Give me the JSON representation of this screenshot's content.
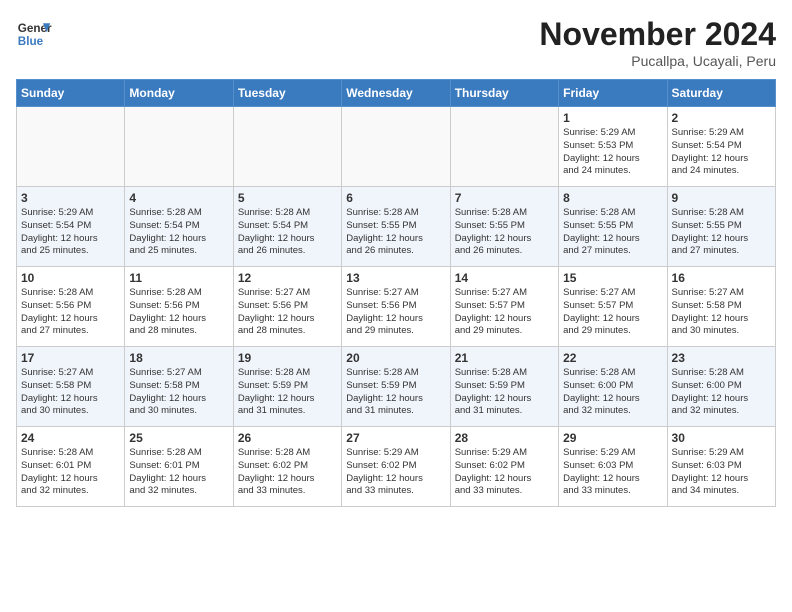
{
  "header": {
    "logo_line1": "General",
    "logo_line2": "Blue",
    "month": "November 2024",
    "location": "Pucallpa, Ucayali, Peru"
  },
  "weekdays": [
    "Sunday",
    "Monday",
    "Tuesday",
    "Wednesday",
    "Thursday",
    "Friday",
    "Saturday"
  ],
  "weeks": [
    [
      {
        "day": "",
        "info": ""
      },
      {
        "day": "",
        "info": ""
      },
      {
        "day": "",
        "info": ""
      },
      {
        "day": "",
        "info": ""
      },
      {
        "day": "",
        "info": ""
      },
      {
        "day": "1",
        "info": "Sunrise: 5:29 AM\nSunset: 5:53 PM\nDaylight: 12 hours\nand 24 minutes."
      },
      {
        "day": "2",
        "info": "Sunrise: 5:29 AM\nSunset: 5:54 PM\nDaylight: 12 hours\nand 24 minutes."
      }
    ],
    [
      {
        "day": "3",
        "info": "Sunrise: 5:29 AM\nSunset: 5:54 PM\nDaylight: 12 hours\nand 25 minutes."
      },
      {
        "day": "4",
        "info": "Sunrise: 5:28 AM\nSunset: 5:54 PM\nDaylight: 12 hours\nand 25 minutes."
      },
      {
        "day": "5",
        "info": "Sunrise: 5:28 AM\nSunset: 5:54 PM\nDaylight: 12 hours\nand 26 minutes."
      },
      {
        "day": "6",
        "info": "Sunrise: 5:28 AM\nSunset: 5:55 PM\nDaylight: 12 hours\nand 26 minutes."
      },
      {
        "day": "7",
        "info": "Sunrise: 5:28 AM\nSunset: 5:55 PM\nDaylight: 12 hours\nand 26 minutes."
      },
      {
        "day": "8",
        "info": "Sunrise: 5:28 AM\nSunset: 5:55 PM\nDaylight: 12 hours\nand 27 minutes."
      },
      {
        "day": "9",
        "info": "Sunrise: 5:28 AM\nSunset: 5:55 PM\nDaylight: 12 hours\nand 27 minutes."
      }
    ],
    [
      {
        "day": "10",
        "info": "Sunrise: 5:28 AM\nSunset: 5:56 PM\nDaylight: 12 hours\nand 27 minutes."
      },
      {
        "day": "11",
        "info": "Sunrise: 5:28 AM\nSunset: 5:56 PM\nDaylight: 12 hours\nand 28 minutes."
      },
      {
        "day": "12",
        "info": "Sunrise: 5:27 AM\nSunset: 5:56 PM\nDaylight: 12 hours\nand 28 minutes."
      },
      {
        "day": "13",
        "info": "Sunrise: 5:27 AM\nSunset: 5:56 PM\nDaylight: 12 hours\nand 29 minutes."
      },
      {
        "day": "14",
        "info": "Sunrise: 5:27 AM\nSunset: 5:57 PM\nDaylight: 12 hours\nand 29 minutes."
      },
      {
        "day": "15",
        "info": "Sunrise: 5:27 AM\nSunset: 5:57 PM\nDaylight: 12 hours\nand 29 minutes."
      },
      {
        "day": "16",
        "info": "Sunrise: 5:27 AM\nSunset: 5:58 PM\nDaylight: 12 hours\nand 30 minutes."
      }
    ],
    [
      {
        "day": "17",
        "info": "Sunrise: 5:27 AM\nSunset: 5:58 PM\nDaylight: 12 hours\nand 30 minutes."
      },
      {
        "day": "18",
        "info": "Sunrise: 5:27 AM\nSunset: 5:58 PM\nDaylight: 12 hours\nand 30 minutes."
      },
      {
        "day": "19",
        "info": "Sunrise: 5:28 AM\nSunset: 5:59 PM\nDaylight: 12 hours\nand 31 minutes."
      },
      {
        "day": "20",
        "info": "Sunrise: 5:28 AM\nSunset: 5:59 PM\nDaylight: 12 hours\nand 31 minutes."
      },
      {
        "day": "21",
        "info": "Sunrise: 5:28 AM\nSunset: 5:59 PM\nDaylight: 12 hours\nand 31 minutes."
      },
      {
        "day": "22",
        "info": "Sunrise: 5:28 AM\nSunset: 6:00 PM\nDaylight: 12 hours\nand 32 minutes."
      },
      {
        "day": "23",
        "info": "Sunrise: 5:28 AM\nSunset: 6:00 PM\nDaylight: 12 hours\nand 32 minutes."
      }
    ],
    [
      {
        "day": "24",
        "info": "Sunrise: 5:28 AM\nSunset: 6:01 PM\nDaylight: 12 hours\nand 32 minutes."
      },
      {
        "day": "25",
        "info": "Sunrise: 5:28 AM\nSunset: 6:01 PM\nDaylight: 12 hours\nand 32 minutes."
      },
      {
        "day": "26",
        "info": "Sunrise: 5:28 AM\nSunset: 6:02 PM\nDaylight: 12 hours\nand 33 minutes."
      },
      {
        "day": "27",
        "info": "Sunrise: 5:29 AM\nSunset: 6:02 PM\nDaylight: 12 hours\nand 33 minutes."
      },
      {
        "day": "28",
        "info": "Sunrise: 5:29 AM\nSunset: 6:02 PM\nDaylight: 12 hours\nand 33 minutes."
      },
      {
        "day": "29",
        "info": "Sunrise: 5:29 AM\nSunset: 6:03 PM\nDaylight: 12 hours\nand 33 minutes."
      },
      {
        "day": "30",
        "info": "Sunrise: 5:29 AM\nSunset: 6:03 PM\nDaylight: 12 hours\nand 34 minutes."
      }
    ]
  ]
}
